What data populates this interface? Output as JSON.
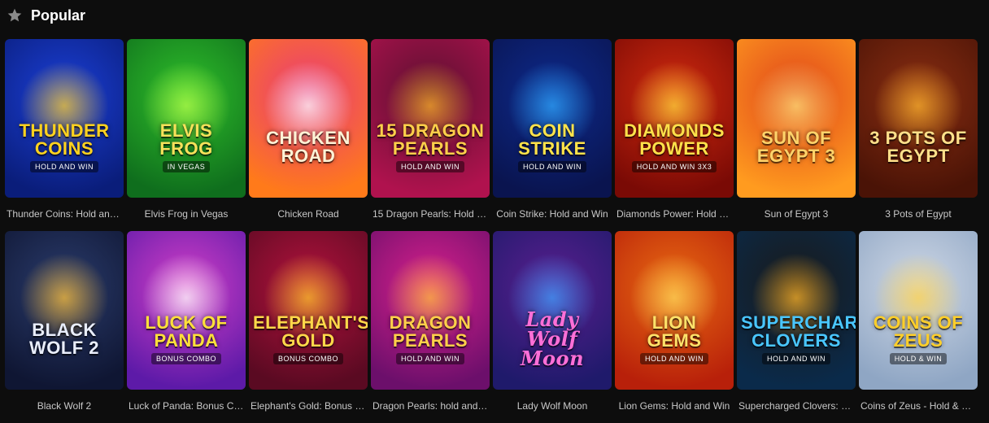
{
  "section": {
    "icon": "star-icon",
    "title": "Popular"
  },
  "games": [
    {
      "name": "Thunder Coins: Hold and ...",
      "logo": "THUNDER\nCOINS",
      "sub": "HOLD AND WIN",
      "bg": "#1b3fd6",
      "bg2": "#0a1d7a",
      "glow": "#ffcf2b",
      "logo_color": "#ffd21f"
    },
    {
      "name": "Elvis Frog in Vegas",
      "logo": "ELVIS FROG",
      "sub": "IN VEGAS",
      "bg": "#2fbf2a",
      "bg2": "#0f6e1d",
      "glow": "#b7ff4a",
      "logo_color": "#f6e15a"
    },
    {
      "name": "Chicken Road",
      "logo": "CHICKEN\nROAD",
      "sub": "",
      "bg": "#e83a7a",
      "bg2": "#ff7a1a",
      "glow": "#ffffff",
      "logo_color": "#fff3d6"
    },
    {
      "name": "15 Dragon Pearls: Hold an...",
      "logo": "15 DRAGON\nPEARLS",
      "sub": "HOLD AND WIN",
      "bg": "#5a1030",
      "bg2": "#b0124e",
      "glow": "#ffb12a",
      "logo_color": "#ffd04a"
    },
    {
      "name": "Coin Strike: Hold and Win",
      "logo": "COIN\nSTRIKE",
      "sub": "HOLD AND WIN",
      "bg": "#0d2a8c",
      "bg2": "#0a144f",
      "glow": "#2fa8ff",
      "logo_color": "#ffe34a"
    },
    {
      "name": "Diamonds Power: Hold an...",
      "logo": "DIAMONDS\nPOWER",
      "sub": "HOLD AND WIN 3X3",
      "bg": "#d12a0f",
      "bg2": "#7a0a05",
      "glow": "#ffd83a",
      "logo_color": "#ffe14a"
    },
    {
      "name": "Sun of Egypt 3",
      "logo": "SUN OF\nEGYPT 3",
      "sub": "",
      "bg": "#e0451b",
      "bg2": "#ff9b1f",
      "glow": "#ffe37a",
      "logo_color": "#ffd36a"
    },
    {
      "name": "3 Pots of Egypt",
      "logo": "3 POTS OF EGYPT",
      "sub": "",
      "bg": "#8a2e12",
      "bg2": "#4a1306",
      "glow": "#ffb52e",
      "logo_color": "#ffe08a"
    },
    {
      "name": "Black Wolf 2",
      "logo": "BLACK\nWOLF 2",
      "sub": "",
      "bg": "#2a3b6b",
      "bg2": "#0f1633",
      "glow": "#ffc13a",
      "logo_color": "#e9eefc"
    },
    {
      "name": "Luck of Panda: Bonus Co...",
      "logo": "LUCK OF\nPANDA",
      "sub": "BONUS COMBO",
      "bg": "#d23fc7",
      "bg2": "#5d1aa8",
      "glow": "#ffffff",
      "logo_color": "#ffe03a"
    },
    {
      "name": "Elephant's Gold: Bonus C...",
      "logo": "ELEPHANT'S\nGOLD",
      "sub": "BONUS COMBO",
      "bg": "#b3123d",
      "bg2": "#5a0a22",
      "glow": "#ffc72a",
      "logo_color": "#ffd84a"
    },
    {
      "name": "Dragon Pearls: hold and ...",
      "logo": "DRAGON\nPEARLS",
      "sub": "HOLD AND WIN",
      "bg": "#d8208c",
      "bg2": "#6c0f6b",
      "glow": "#ffbf3a",
      "logo_color": "#ffd04a"
    },
    {
      "name": "Lady Wolf Moon",
      "logo": "Lady Wolf\nMoon",
      "sub": "",
      "bg": "#5a1f8f",
      "bg2": "#1f1a6b",
      "glow": "#3fa0ff",
      "logo_color": "#ff6fd8"
    },
    {
      "name": "Lion Gems: Hold and Win",
      "logo": "LION\nGEMS",
      "sub": "HOLD AND WIN",
      "bg": "#e86a12",
      "bg2": "#b8200a",
      "glow": "#ffd95a",
      "logo_color": "#ffe26a"
    },
    {
      "name": "Supercharged Clovers: Ho...",
      "logo": "SUPERCHARGED\nCLOVERS",
      "sub": "HOLD AND WIN",
      "bg": "#1a1a1a",
      "bg2": "#0a2a4a",
      "glow": "#ffb52a",
      "logo_color": "#49c6ff"
    },
    {
      "name": "Coins of Zeus - Hold & Win",
      "logo": "COINS OF\nZEUS",
      "sub": "HOLD & WIN",
      "bg": "#cfd8e6",
      "bg2": "#8fa6c4",
      "glow": "#ffd24a",
      "logo_color": "#ffcf2a"
    }
  ]
}
